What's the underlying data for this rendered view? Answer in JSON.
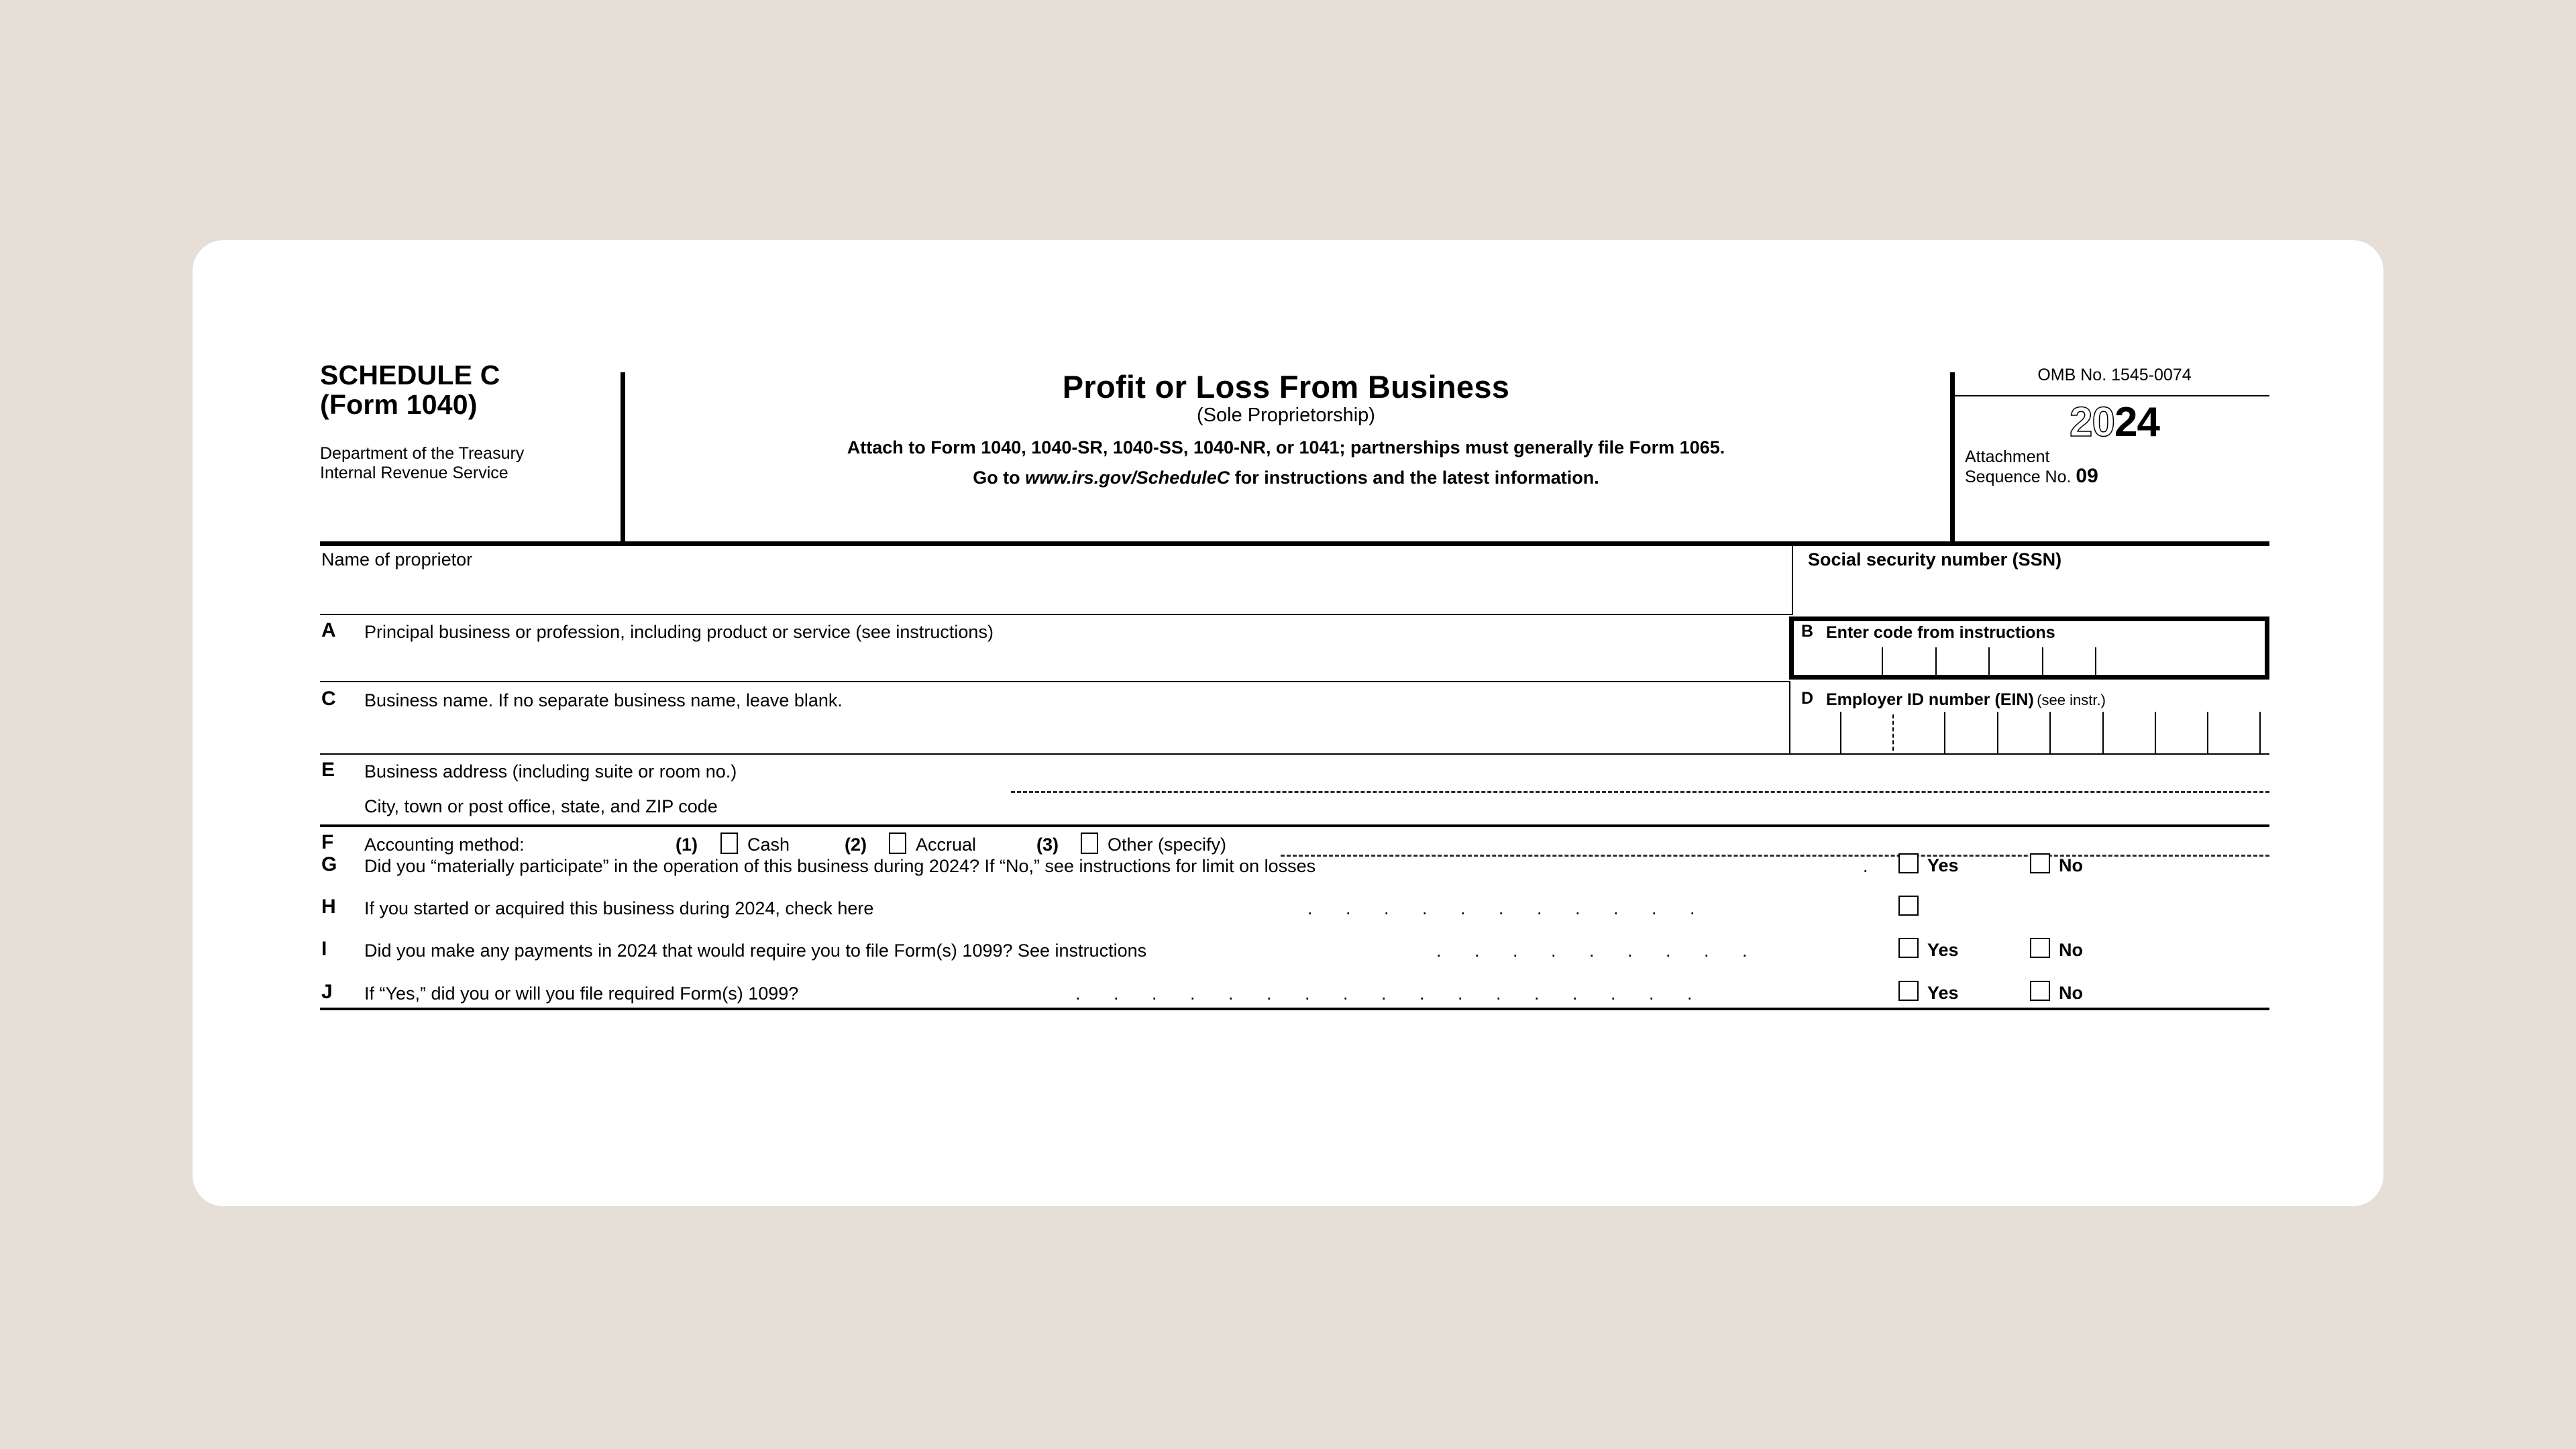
{
  "theme": {
    "page_background": "#e6dfd7",
    "card_background": "#ffffff",
    "ink": "#000000"
  },
  "header": {
    "schedule_title": "SCHEDULE C\n(Form 1040)",
    "department": "Department of the Treasury\nInternal Revenue Service",
    "main_title": "Profit or Loss From Business",
    "sub_title": "(Sole Proprietorship)",
    "attach_line": "Attach to Form 1040, 1040-SR, 1040-SS, 1040-NR, or 1041; partnerships must generally file Form 1065.",
    "goto_prefix": "Go to ",
    "goto_url": "www.irs.gov/ScheduleC",
    "goto_suffix": " for instructions and the latest information.",
    "omb": "OMB No. 1545-0074",
    "year_light": "20",
    "year_bold": "24",
    "attachment_label": "Attachment",
    "sequence_label": "Sequence No. ",
    "sequence_number": "09"
  },
  "fields": {
    "name_of_proprietor": {
      "label": "Name of proprietor",
      "value": ""
    },
    "ssn": {
      "label": "Social security number (SSN)",
      "value": ""
    },
    "a": {
      "letter": "A",
      "label": "Principal business or profession, including product or service (see instructions)",
      "value": ""
    },
    "b": {
      "letter": "B",
      "label": "Enter code from instructions",
      "cells": 6,
      "value": ""
    },
    "c": {
      "letter": "C",
      "label": "Business name. If no separate business name, leave blank.",
      "value": ""
    },
    "d": {
      "letter": "D",
      "label": "Employer ID number (EIN)",
      "label_suffix": "(see instr.)",
      "cells": 9,
      "value": ""
    },
    "e": {
      "letter": "E",
      "label": "Business address (including suite or room no.)",
      "label2": "City, town or post office, state, and ZIP code",
      "value": "",
      "value2": ""
    },
    "f": {
      "letter": "F",
      "label": "Accounting method:",
      "options": [
        {
          "num": "(1)",
          "label": "Cash",
          "checked": false
        },
        {
          "num": "(2)",
          "label": "Accrual",
          "checked": false
        },
        {
          "num": "(3)",
          "label": "Other (specify)",
          "checked": false
        }
      ],
      "other_value": ""
    },
    "g": {
      "letter": "G",
      "label": "Did you “materially participate” in the operation of this business during 2024? If “No,” see instructions for limit on losses",
      "leader": ".",
      "yes_label": "Yes",
      "no_label": "No",
      "yes_checked": false,
      "no_checked": false
    },
    "h": {
      "letter": "H",
      "label": "If you started or acquired this business during 2024, check here",
      "leader": ". . . . . . . . . . .",
      "checked": false
    },
    "i": {
      "letter": "I",
      "label": "Did you make any payments in 2024 that would require you to file Form(s) 1099? See instructions",
      "leader": ". . . . . . . . .",
      "yes_label": "Yes",
      "no_label": "No",
      "yes_checked": false,
      "no_checked": false
    },
    "j": {
      "letter": "J",
      "label": "If “Yes,” did you or will you file required Form(s) 1099?",
      "leader": ". . . . . . . . . . . . . . . . .",
      "yes_label": "Yes",
      "no_label": "No",
      "yes_checked": false,
      "no_checked": false
    }
  }
}
